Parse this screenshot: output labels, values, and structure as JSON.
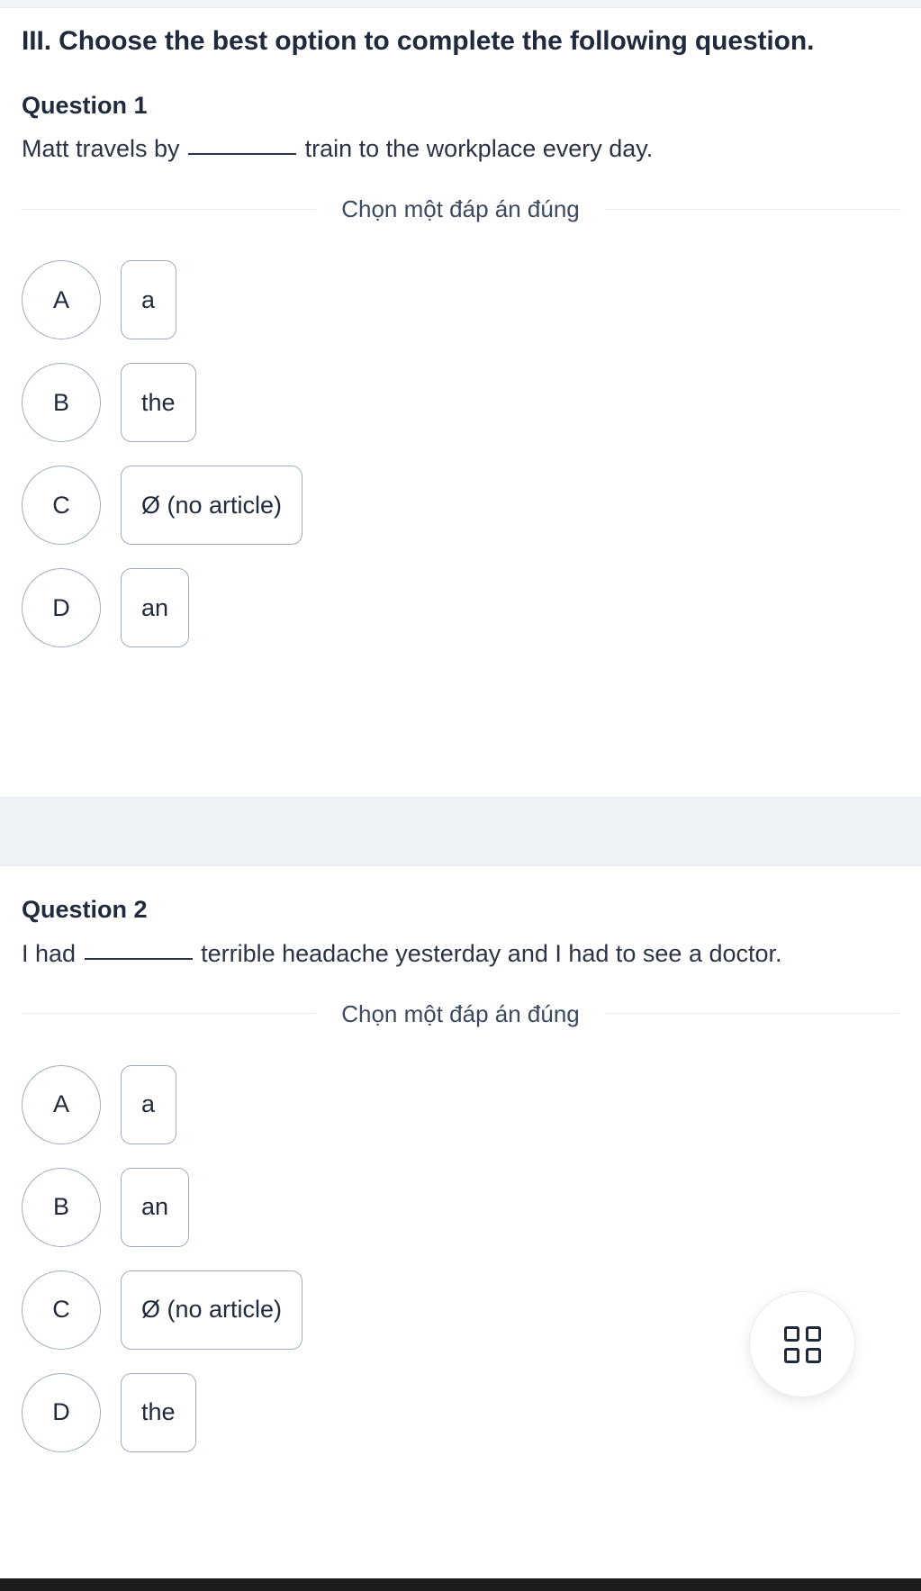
{
  "part": {
    "heading": "III. Choose the best option to complete the following question."
  },
  "choose_caption": "Chọn một đáp án đúng",
  "questions": [
    {
      "label": "Question 1",
      "text_before": "Matt travels by",
      "text_after": "train to the workplace every day.",
      "options": [
        {
          "letter": "A",
          "text": "a"
        },
        {
          "letter": "B",
          "text": "the"
        },
        {
          "letter": "C",
          "text": "Ø (no article)"
        },
        {
          "letter": "D",
          "text": "an"
        }
      ]
    },
    {
      "label": "Question 2",
      "text_before": "I had",
      "text_after": "terrible headache yesterday and I had to see a doctor.",
      "options": [
        {
          "letter": "A",
          "text": "a"
        },
        {
          "letter": "B",
          "text": "an"
        },
        {
          "letter": "C",
          "text": "Ø (no article)"
        },
        {
          "letter": "D",
          "text": "the"
        }
      ]
    }
  ],
  "fab": {
    "icon": "grid-icon"
  },
  "colors": {
    "text": "#1f2a3d",
    "border": "#9fadc1",
    "band": "#eef1f6",
    "rule": "#e6eaf2"
  }
}
